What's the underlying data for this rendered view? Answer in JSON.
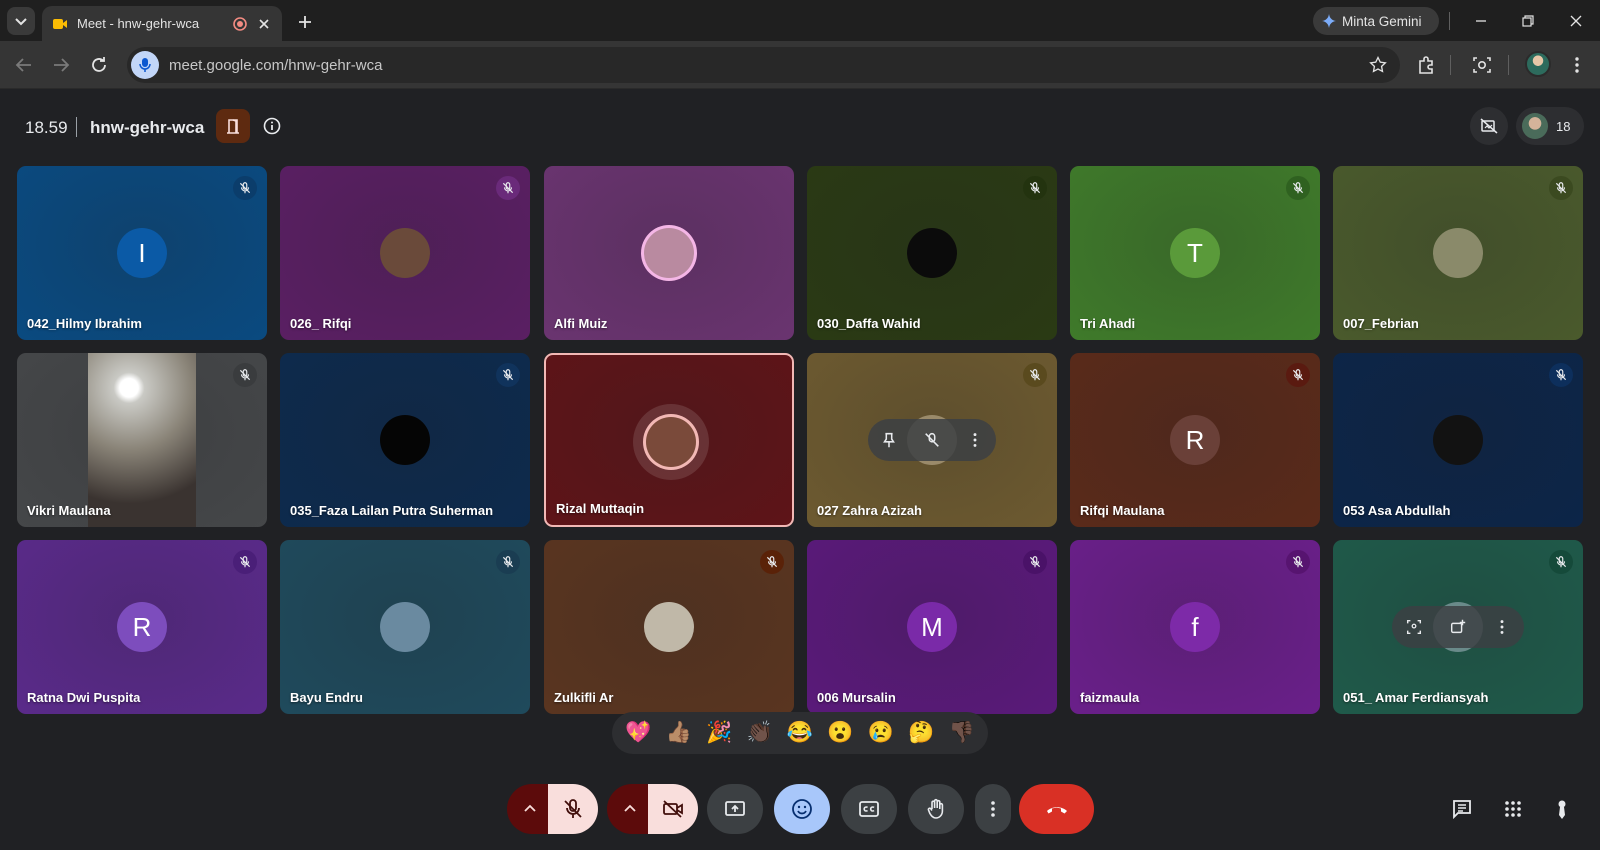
{
  "browser": {
    "tab_title": "Meet - hnw-gehr-wca",
    "gemini_label": "Minta Gemini",
    "url": "meet.google.com/hnw-gehr-wca"
  },
  "meet": {
    "time": "18.59",
    "meeting_code": "hnw-gehr-wca",
    "participant_count": "18"
  },
  "tiles": [
    {
      "name": "042_Hilmy Ibrahim",
      "initial": "I",
      "bg": "#0a4a80",
      "avatar_bg": "#0b5aa6",
      "mute_bg": "#0b3d6b"
    },
    {
      "name": "026_ Rifqi",
      "initial": "",
      "bg": "#5a1f63",
      "avatar_bg": "#6a4a3a",
      "mute_bg": "#6a2a7a"
    },
    {
      "name": "Alfi Muiz",
      "initial": "",
      "bg": "#6a3470",
      "avatar_bg": "#b98aa0",
      "mute_bg": ""
    },
    {
      "name": "030_Daffa Wahid",
      "initial": "",
      "bg": "#2a3a14",
      "avatar_bg": "#0b0b0b",
      "mute_bg": "#23330f"
    },
    {
      "name": "Tri Ahadi",
      "initial": "T",
      "bg": "#3f7a2a",
      "avatar_bg": "#5a9a3a",
      "mute_bg": "#2f6120"
    },
    {
      "name": "007_Febrian",
      "initial": "",
      "bg": "#4a5a2c",
      "avatar_bg": "#8a8a6a",
      "mute_bg": "#3b4a20"
    },
    {
      "name": "Vikri Maulana",
      "initial": "",
      "bg": "#454749",
      "avatar_bg": "",
      "mute_bg": "#3a3c3e"
    },
    {
      "name": "035_Faza Lailan Putra Suherman",
      "initial": "",
      "bg": "#0d2a4d",
      "avatar_bg": "#050505",
      "mute_bg": "#10335c"
    },
    {
      "name": "Rizal Muttaqin",
      "initial": "",
      "bg": "#5e1418",
      "avatar_bg": "#7a4a3a",
      "mute_bg": ""
    },
    {
      "name": "027 Zahra Azizah",
      "initial": "",
      "bg": "#6d5a30",
      "avatar_bg": "#9a8a6a",
      "mute_bg": "#5a4a1e"
    },
    {
      "name": "Rifqi Maulana",
      "initial": "R",
      "bg": "#5a2a1a",
      "avatar_bg": "#6a4038",
      "mute_bg": "#5a1a10"
    },
    {
      "name": "053 Asa Abdullah",
      "initial": "",
      "bg": "#0c2548",
      "avatar_bg": "#121212",
      "mute_bg": "#0d2f5c"
    },
    {
      "name": "Ratna Dwi Puspita",
      "initial": "R",
      "bg": "#5a2a8a",
      "avatar_bg": "#7d4dbd",
      "mute_bg": "#4a1f78"
    },
    {
      "name": "Bayu Endru",
      "initial": "",
      "bg": "#1f4a5c",
      "avatar_bg": "#6a8aa0",
      "mute_bg": "#1a3d52"
    },
    {
      "name": "Zulkifli Ar",
      "initial": "",
      "bg": "#5a3520",
      "avatar_bg": "#c0b8a8",
      "mute_bg": "#5a2208"
    },
    {
      "name": "006 Mursalin",
      "initial": "M",
      "bg": "#5a1a7a",
      "avatar_bg": "#7a2aa8",
      "mute_bg": "#4a1268"
    },
    {
      "name": "faizmaula",
      "initial": "f",
      "bg": "#6a1f8a",
      "avatar_bg": "#7d2aa8",
      "mute_bg": "#571470"
    },
    {
      "name": "051_ Amar Ferdiansyah",
      "initial": "",
      "bg": "#1f5a4a",
      "avatar_bg": "#6a8a8a",
      "mute_bg": "#154a3a"
    }
  ],
  "reactions": [
    "💖",
    "👍🏽",
    "🎉",
    "👏🏿",
    "😂",
    "😮",
    "😢",
    "🤔",
    "👎🏿"
  ],
  "colors": {
    "end_call": "#d93025",
    "muted_pink": "#f9dedc",
    "emoji_active": "#a8c7fa"
  }
}
